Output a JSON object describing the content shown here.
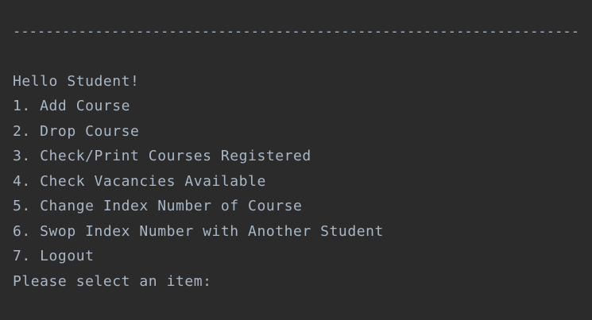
{
  "console": {
    "separator": "---------------------------------------------------------------------",
    "greeting": "Hello Student!",
    "menu_items": [
      "1. Add Course",
      "2. Drop Course",
      "3. Check/Print Courses Registered",
      "4. Check Vacancies Available",
      "5. Change Index Number of Course",
      "6. Swop Index Number with Another Student",
      "7. Logout"
    ],
    "prompt": "Please select an item:"
  },
  "colors": {
    "background": "#2b2b2b",
    "text": "#a9b7c6"
  }
}
